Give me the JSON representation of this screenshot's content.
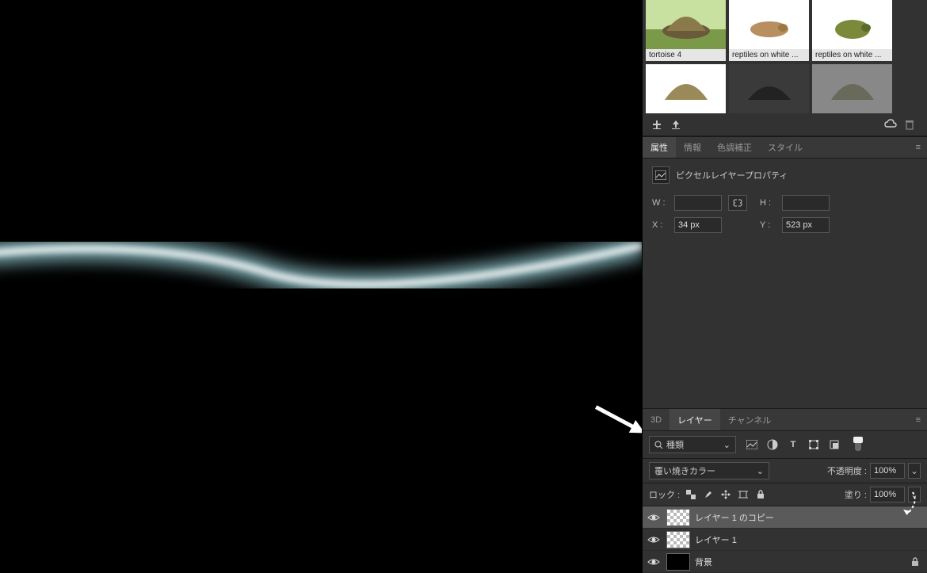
{
  "library": {
    "items": [
      {
        "label": "tortoise 4",
        "bg": "grass"
      },
      {
        "label": "reptiles on white ...",
        "bg": "white"
      },
      {
        "label": "reptiles on white ...",
        "bg": "white"
      }
    ]
  },
  "properties": {
    "tabs": {
      "zokusei": "属性",
      "joho": "情報",
      "shikicho": "色調補正",
      "style": "スタイル"
    },
    "title": "ピクセルレイヤープロパティ",
    "labels": {
      "w": "W :",
      "h": "H :",
      "x": "X :",
      "y": "Y :"
    },
    "values": {
      "w": "",
      "h": "",
      "x": "34 px",
      "y": "523 px"
    }
  },
  "layers": {
    "tabs": {
      "threeD": "3D",
      "layer": "レイヤー",
      "channel": "チャンネル"
    },
    "kind_label": "種類",
    "blend_mode": "覆い焼きカラー",
    "opacity_label": "不透明度 :",
    "opacity_value": "100%",
    "fill_label": "塗り :",
    "fill_value": "100%",
    "lock_label": "ロック :",
    "items": [
      {
        "name": "レイヤー 1 のコピー",
        "checker": true,
        "selected": true,
        "locked": false
      },
      {
        "name": "レイヤー 1",
        "checker": true,
        "selected": false,
        "locked": false
      },
      {
        "name": "背景",
        "checker": false,
        "selected": false,
        "locked": true
      }
    ]
  }
}
